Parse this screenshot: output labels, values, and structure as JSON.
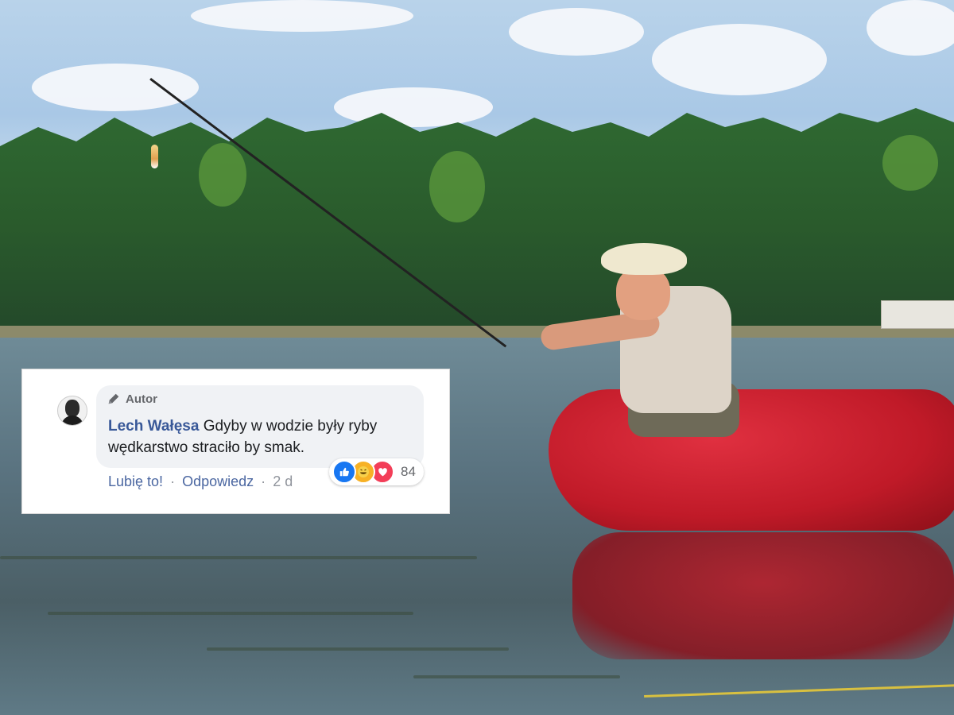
{
  "comment": {
    "badge": "Autor",
    "author": "Lech Wałęsa",
    "text": "Gdyby w wodzie były ryby wędkarstwo straciło by smak.",
    "actions": {
      "like": "Lubię to!",
      "separator": "·",
      "reply": "Odpowiedz",
      "time": "2 d"
    },
    "reactions": {
      "icons": [
        "like-icon",
        "haha-icon",
        "love-icon"
      ],
      "count": "84"
    }
  },
  "colors": {
    "author_link": "#385898",
    "bubble": "#f0f2f5",
    "like": "#1877f2",
    "haha": "#f7b125",
    "love": "#f33e58"
  }
}
